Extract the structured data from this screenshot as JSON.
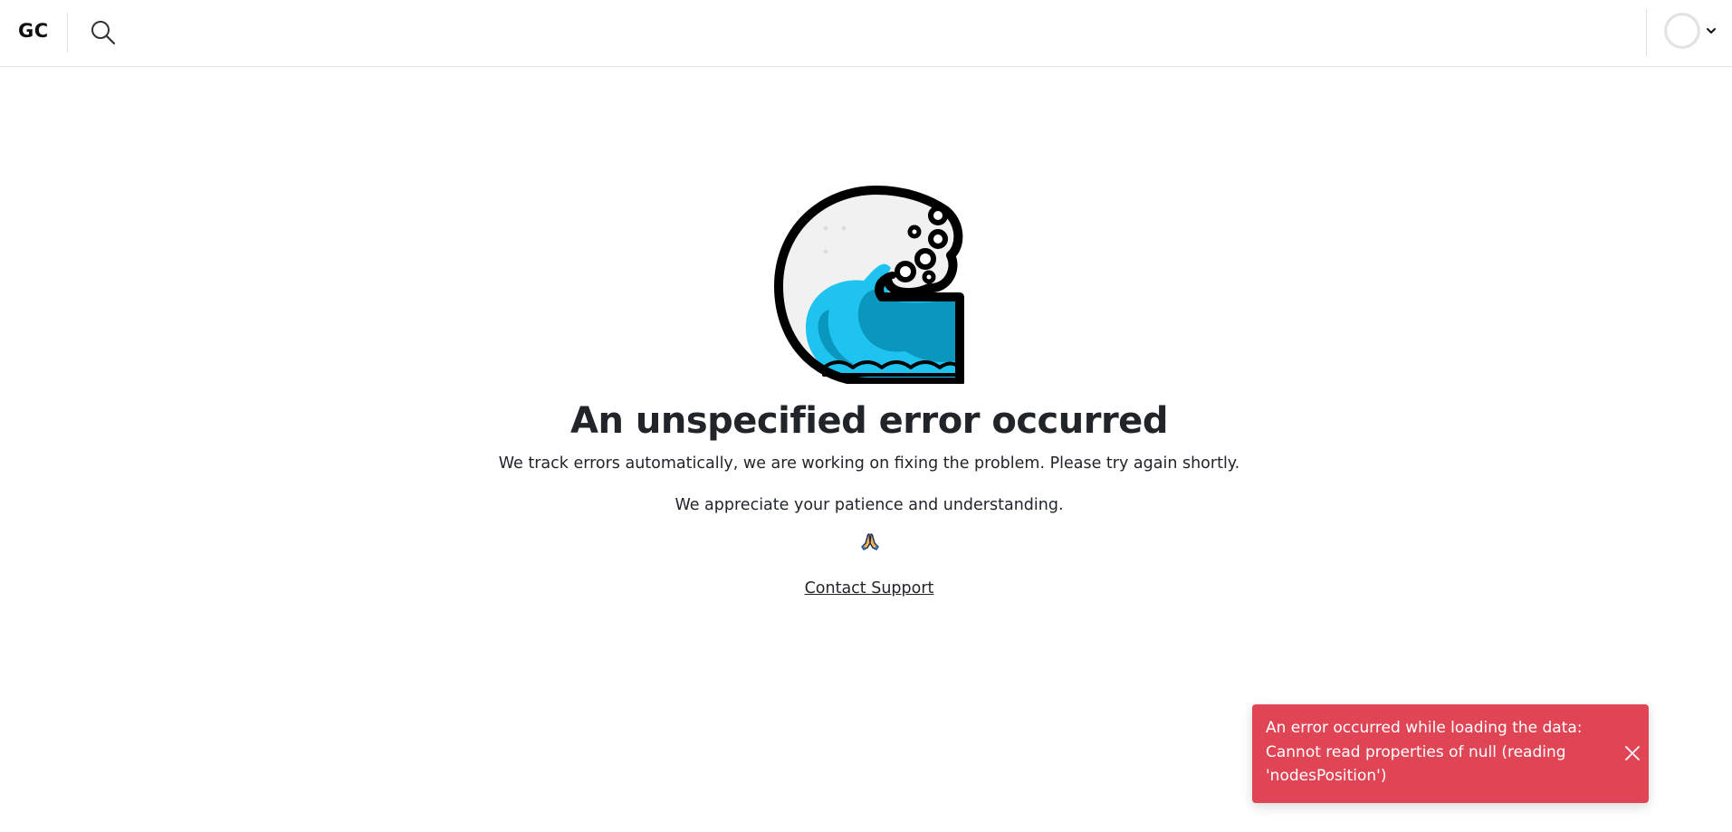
{
  "header": {
    "logo_text": "GC",
    "search_icon": "search-icon",
    "avatar_icon": "avatar",
    "menu_icon": "chevron-down-icon"
  },
  "error_page": {
    "illustration": "wave-icon",
    "title": "An unspecified error occurred",
    "description": "We track errors automatically, we are working on fixing the problem. Please try again shortly.",
    "thanks": "We appreciate your patience and understanding.",
    "emoji_icon": "folded-hands-icon",
    "support_link": "Contact Support"
  },
  "toast": {
    "message": "An error occurred while loading the data: Cannot read properties of null (reading 'nodesPosition')",
    "close_icon": "close-icon",
    "color": "#e04556"
  },
  "colors": {
    "text": "#212529",
    "border": "#dee2e6",
    "wave_light": "#1ec3f0",
    "wave_dark": "#0a97bd",
    "error": "#e04556"
  }
}
